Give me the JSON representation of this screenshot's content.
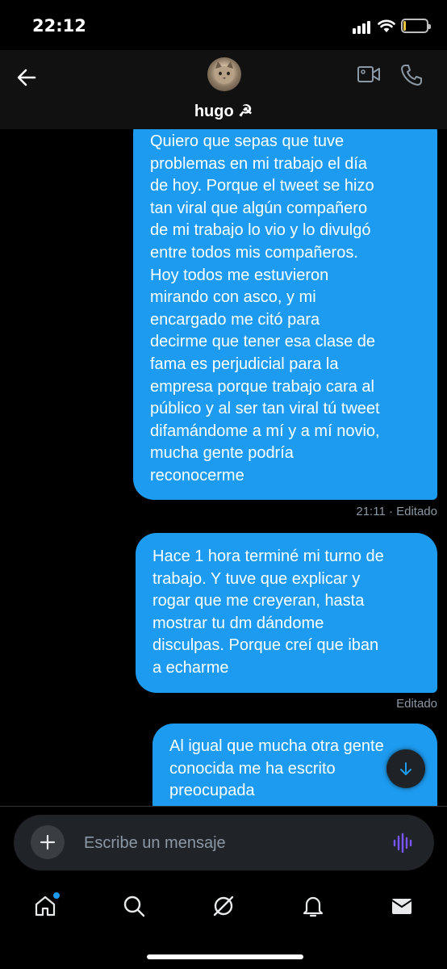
{
  "status_bar": {
    "time": "22:12",
    "battery_level": "10",
    "battery_fraction": 0.1
  },
  "header": {
    "contact_name": "hugo ☭"
  },
  "messages": [
    {
      "lines": [
        "Quiero que sepas que tuve",
        "problemas en mi trabajo el día",
        "de hoy. Porque el tweet se hizo",
        "tan viral que algún compañero",
        "de mi trabajo lo vio y lo divulgó",
        "entre todos mis compañeros.",
        "Hoy todos me estuvieron",
        "mirando con asco, y mi",
        "encargado me citó para",
        "decirme que tener esa clase de",
        "fama es perjudicial para la",
        "empresa porque trabajo cara al",
        "público y al ser tan viral tú tweet",
        "difamándome a mí y a mí novio,",
        "mucha gente podría",
        "reconocerme"
      ],
      "meta": "21:11 · Editado"
    },
    {
      "lines": [
        "Hace 1 hora terminé mi turno de",
        "trabajo. Y tuve que explicar y",
        "rogar que me creyeran, hasta",
        "mostrar tu dm dándome",
        "disculpas. Porque creí que iban",
        "a echarme"
      ],
      "meta": "Editado"
    },
    {
      "lines": [
        "Al igual que mucha otra gente",
        "conocida me ha escrito",
        "preocupada"
      ]
    }
  ],
  "composer": {
    "placeholder": "Escribe un mensaje"
  },
  "icons": {
    "back": "arrow-left-icon",
    "video": "video-camera-icon",
    "phone": "phone-icon",
    "scroll": "arrow-down-icon",
    "add": "plus-icon",
    "voice": "voice-wave-icon",
    "tabs": [
      "home-icon",
      "search-icon",
      "grok-icon",
      "bell-icon",
      "mail-icon"
    ]
  },
  "colors": {
    "bubble": "#1d9bf0",
    "background": "#000000",
    "meta_text": "#8b98a5",
    "voice_accent": "#7856ff",
    "battery": "#e8c73d"
  }
}
